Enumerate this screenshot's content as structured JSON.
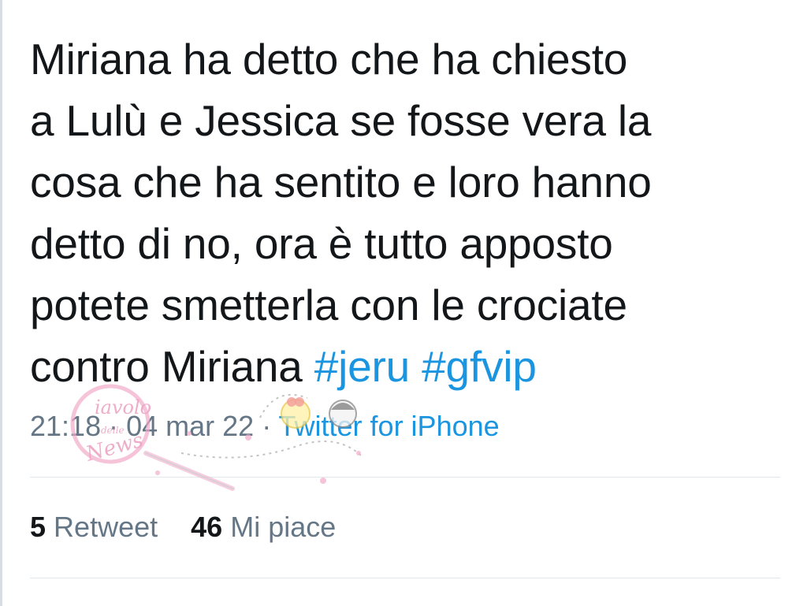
{
  "tweet": {
    "lines": [
      "Miriana ha detto che ha chiesto",
      "a Lulù e Jessica se fosse vera la",
      "cosa che ha sentito e loro hanno",
      "detto di no, ora è tutto apposto",
      "potete smetterla con le crociate"
    ],
    "last_line_text": "contro Miriana ",
    "hashtags": [
      "#jeru",
      "#gfvip"
    ]
  },
  "meta": {
    "time": "21:18",
    "separator": " · ",
    "date": "04 mar 22",
    "source": "Twitter for iPhone"
  },
  "stats": {
    "retweets_count": "5",
    "retweets_label": "Retweet",
    "likes_count": "46",
    "likes_label": "Mi piace"
  },
  "watermark": {
    "text": "Diavolo delle News"
  },
  "colors": {
    "text": "#14171a",
    "link": "#1b95e0",
    "secondary": "#657786",
    "divider": "#e1e8ed"
  }
}
